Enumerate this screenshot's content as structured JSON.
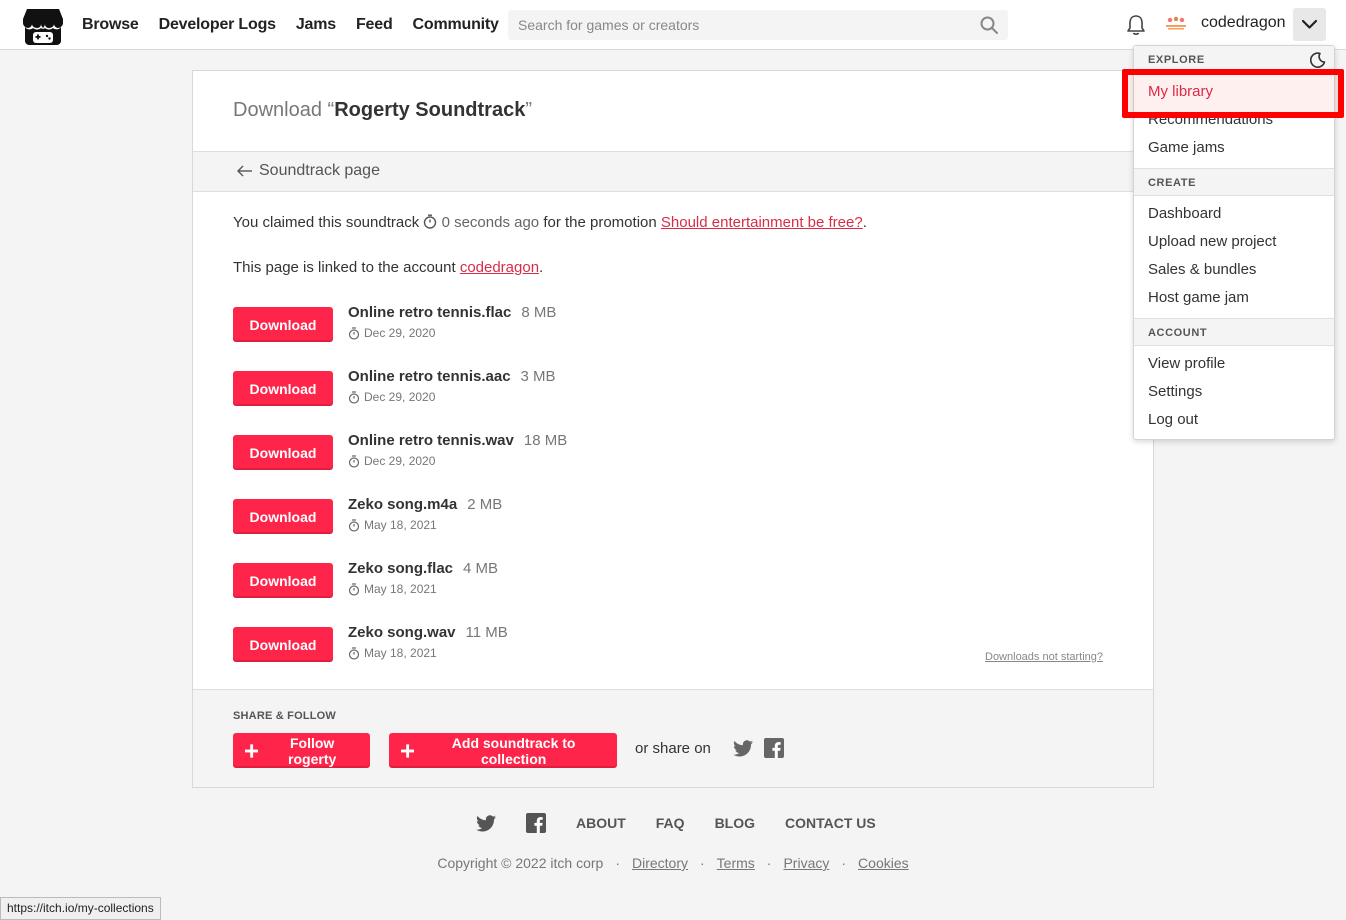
{
  "header": {
    "nav": [
      "Browse",
      "Developer Logs",
      "Jams",
      "Feed",
      "Community"
    ],
    "search_placeholder": "Search for games or creators",
    "username": "codedragon"
  },
  "card": {
    "title_prefix": "Download ",
    "title_open_quote": "“",
    "title_name": "Rogerty Soundtrack",
    "title_close_quote": "”",
    "back_link": "Soundtrack page",
    "claimed_prefix": "You claimed this soundtrack",
    "claimed_time": "0 seconds ago",
    "claimed_middle": "for the promotion",
    "promotion_link": "Should entertainment be free?",
    "claimed_suffix": ".",
    "linked_prefix": "This page is linked to the account",
    "linked_account": "codedragon",
    "linked_suffix": ".",
    "download_label": "Download",
    "files": [
      {
        "name": "Online retro tennis.flac",
        "size": "8 MB",
        "date": "Dec 29, 2020"
      },
      {
        "name": "Online retro tennis.aac",
        "size": "3 MB",
        "date": "Dec 29, 2020"
      },
      {
        "name": "Online retro tennis.wav",
        "size": "18 MB",
        "date": "Dec 29, 2020"
      },
      {
        "name": "Zeko song.m4a",
        "size": "2 MB",
        "date": "May 18, 2021"
      },
      {
        "name": "Zeko song.flac",
        "size": "4 MB",
        "date": "May 18, 2021"
      },
      {
        "name": "Zeko song.wav",
        "size": "11 MB",
        "date": "May 18, 2021"
      }
    ],
    "not_starting": "Downloads not starting?"
  },
  "share": {
    "title": "SHARE & FOLLOW",
    "follow": "Follow rogerty",
    "collection": "Add soundtrack to collection",
    "share_on": "or share on"
  },
  "footer": {
    "links": [
      "ABOUT",
      "FAQ",
      "BLOG",
      "CONTACT US"
    ],
    "copyright": "Copyright © 2022 itch corp",
    "legal": [
      "Directory",
      "Terms",
      "Privacy",
      "Cookies"
    ]
  },
  "status_url": "https://itch.io/my-collections",
  "dropdown": {
    "explore": {
      "heading": "EXPLORE",
      "items": [
        "My library",
        "Recommendations",
        "Game jams"
      ]
    },
    "create": {
      "heading": "CREATE",
      "items": [
        "Dashboard",
        "Upload new project",
        "Sales & bundles",
        "Host game jam"
      ]
    },
    "account": {
      "heading": "ACCOUNT",
      "items": [
        "View profile",
        "Settings",
        "Log out"
      ]
    }
  },
  "colors": {
    "accent": "#ff2449",
    "link": "#da2c49",
    "highlight": "#ff0000"
  }
}
